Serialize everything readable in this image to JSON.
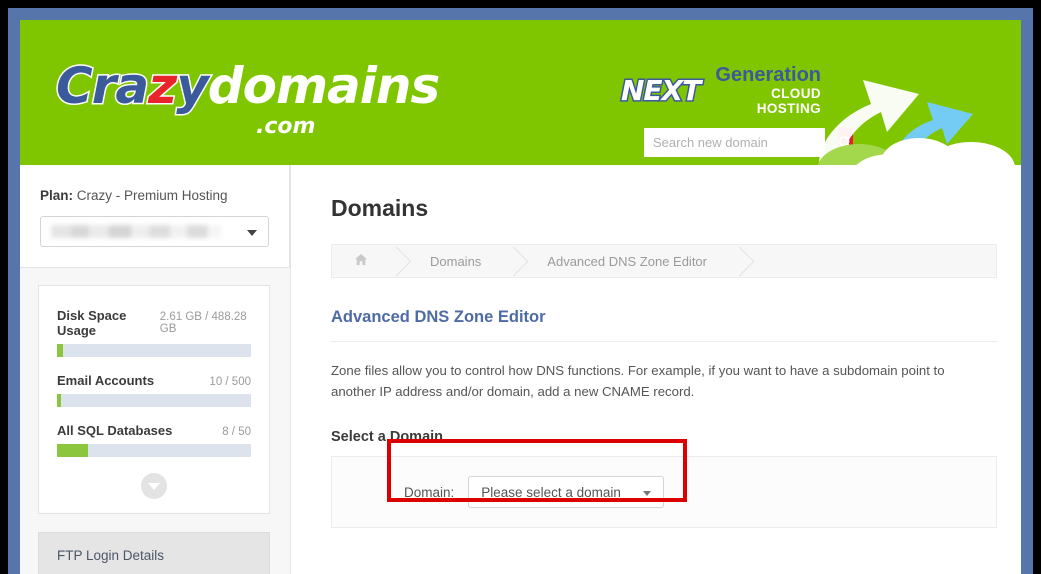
{
  "brand": {
    "logo_part1": "Cra",
    "logo_part2": "z",
    "logo_part3": "y",
    "logo_part4": "domains",
    "logo_tld": ".com",
    "tagline_next": "NEXT",
    "tagline_generation": "Generation",
    "tagline_cloud": "CLOUD HOSTING"
  },
  "colors": {
    "header_green": "#80c600",
    "brand_blue": "#3a5a9b",
    "brand_red": "#e8252b",
    "accent_red": "#ec1c24",
    "highlight_red": "#dd0000",
    "progress_green": "#8cc63e",
    "link_blue": "#4e6ba6",
    "frame_blue": "#5575ab"
  },
  "search": {
    "placeholder": "Search new domain",
    "value": "",
    "button_icon": "search-icon"
  },
  "sidebar": {
    "plan_label": "Plan:",
    "plan_name": "Crazy - Premium Hosting",
    "account_select_value": "",
    "usage": [
      {
        "label": "Disk Space Usage",
        "value": "2.61 GB / 488.28 GB",
        "percent": 3
      },
      {
        "label": "Email Accounts",
        "value": "10 / 500",
        "percent": 2
      },
      {
        "label": "All SQL Databases",
        "value": "8 / 50",
        "percent": 16
      }
    ],
    "expand_icon": "chevron-down-icon",
    "ftp_panel_title": "FTP Login Details"
  },
  "main": {
    "page_title": "Domains",
    "breadcrumb": {
      "home_icon": "home-icon",
      "items": [
        "Domains",
        "Advanced DNS Zone Editor"
      ]
    },
    "section_title": "Advanced DNS Zone Editor",
    "section_description": "Zone files allow you to control how DNS functions. For example, if you want to have a subdomain point to another IP address and/or domain, add a new CNAME record.",
    "subsection_title": "Select a Domain",
    "domain_field": {
      "label": "Domain:",
      "selected_value": "Please select a domain",
      "caret_icon": "chevron-down-icon"
    }
  }
}
